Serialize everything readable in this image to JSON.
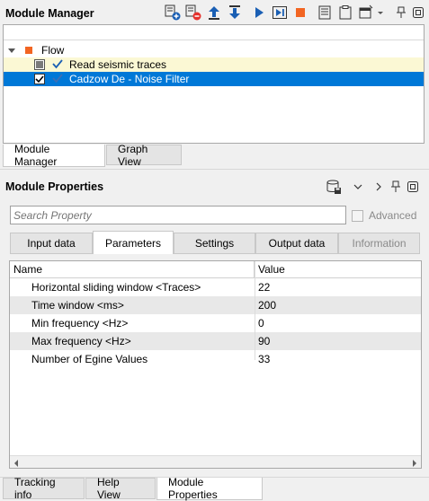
{
  "module_manager": {
    "title": "Module Manager",
    "tree": {
      "root_label": "Flow",
      "items": [
        {
          "label": "Read seismic traces",
          "checked": false
        },
        {
          "label": "Cadzow De - Noise Filter",
          "checked": true
        }
      ]
    },
    "tabs": [
      "Module Manager",
      "Graph View"
    ]
  },
  "module_properties": {
    "title": "Module Properties",
    "search_placeholder": "Search Property",
    "advanced_label": "Advanced",
    "tabs": [
      "Input data",
      "Parameters",
      "Settings",
      "Output data",
      "Information"
    ],
    "active_tab": "Parameters",
    "columns": [
      "Name",
      "Value"
    ],
    "rows": [
      {
        "name": "Horizontal sliding window <Traces>",
        "value": "22"
      },
      {
        "name": "Time window <ms>",
        "value": "200"
      },
      {
        "name": "Min frequency <Hz>",
        "value": "0"
      },
      {
        "name": "Max frequency <Hz>",
        "value": "90"
      },
      {
        "name": "Number of Egine Values",
        "value": "33"
      }
    ]
  },
  "bottom_tabs": [
    "Tracking info",
    "Help View",
    "Module Properties"
  ],
  "colors": {
    "selection": "#0078d7",
    "highlight_row": "#fbf8d4",
    "play_blue": "#1a5fb4",
    "stop_orange": "#f26522",
    "add_blue": "#1a5fb4",
    "remove_red": "#e5322d"
  }
}
